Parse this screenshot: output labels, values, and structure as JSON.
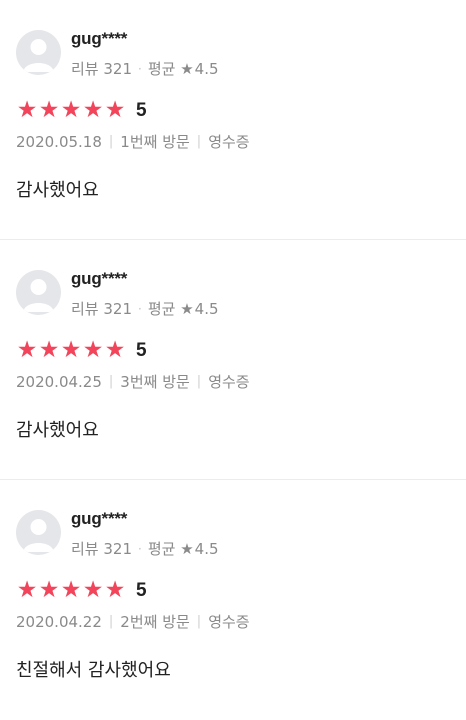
{
  "reviews": [
    {
      "username": "gug****",
      "review_count_label": "리뷰 321",
      "avg_label": "평균",
      "avg_value": "4.5",
      "rating": 5,
      "score": "5",
      "date": "2020.05.18",
      "visit": "1번째 방문",
      "receipt": "영수증",
      "text": "감사했어요"
    },
    {
      "username": "gug****",
      "review_count_label": "리뷰 321",
      "avg_label": "평균",
      "avg_value": "4.5",
      "rating": 5,
      "score": "5",
      "date": "2020.04.25",
      "visit": "3번째 방문",
      "receipt": "영수증",
      "text": "감사했어요"
    },
    {
      "username": "gug****",
      "review_count_label": "리뷰 321",
      "avg_label": "평균",
      "avg_value": "4.5",
      "rating": 5,
      "score": "5",
      "date": "2020.04.22",
      "visit": "2번째 방문",
      "receipt": "영수증",
      "text": "친절해서 감사했어요"
    }
  ],
  "colors": {
    "star": "#f2445a",
    "meta": "#8a8a8a",
    "avatar_bg": "#e5e6ea"
  },
  "icons": {
    "avatar": "user-avatar-icon",
    "rating_star": "star-icon",
    "avg_star": "small-star-icon"
  }
}
